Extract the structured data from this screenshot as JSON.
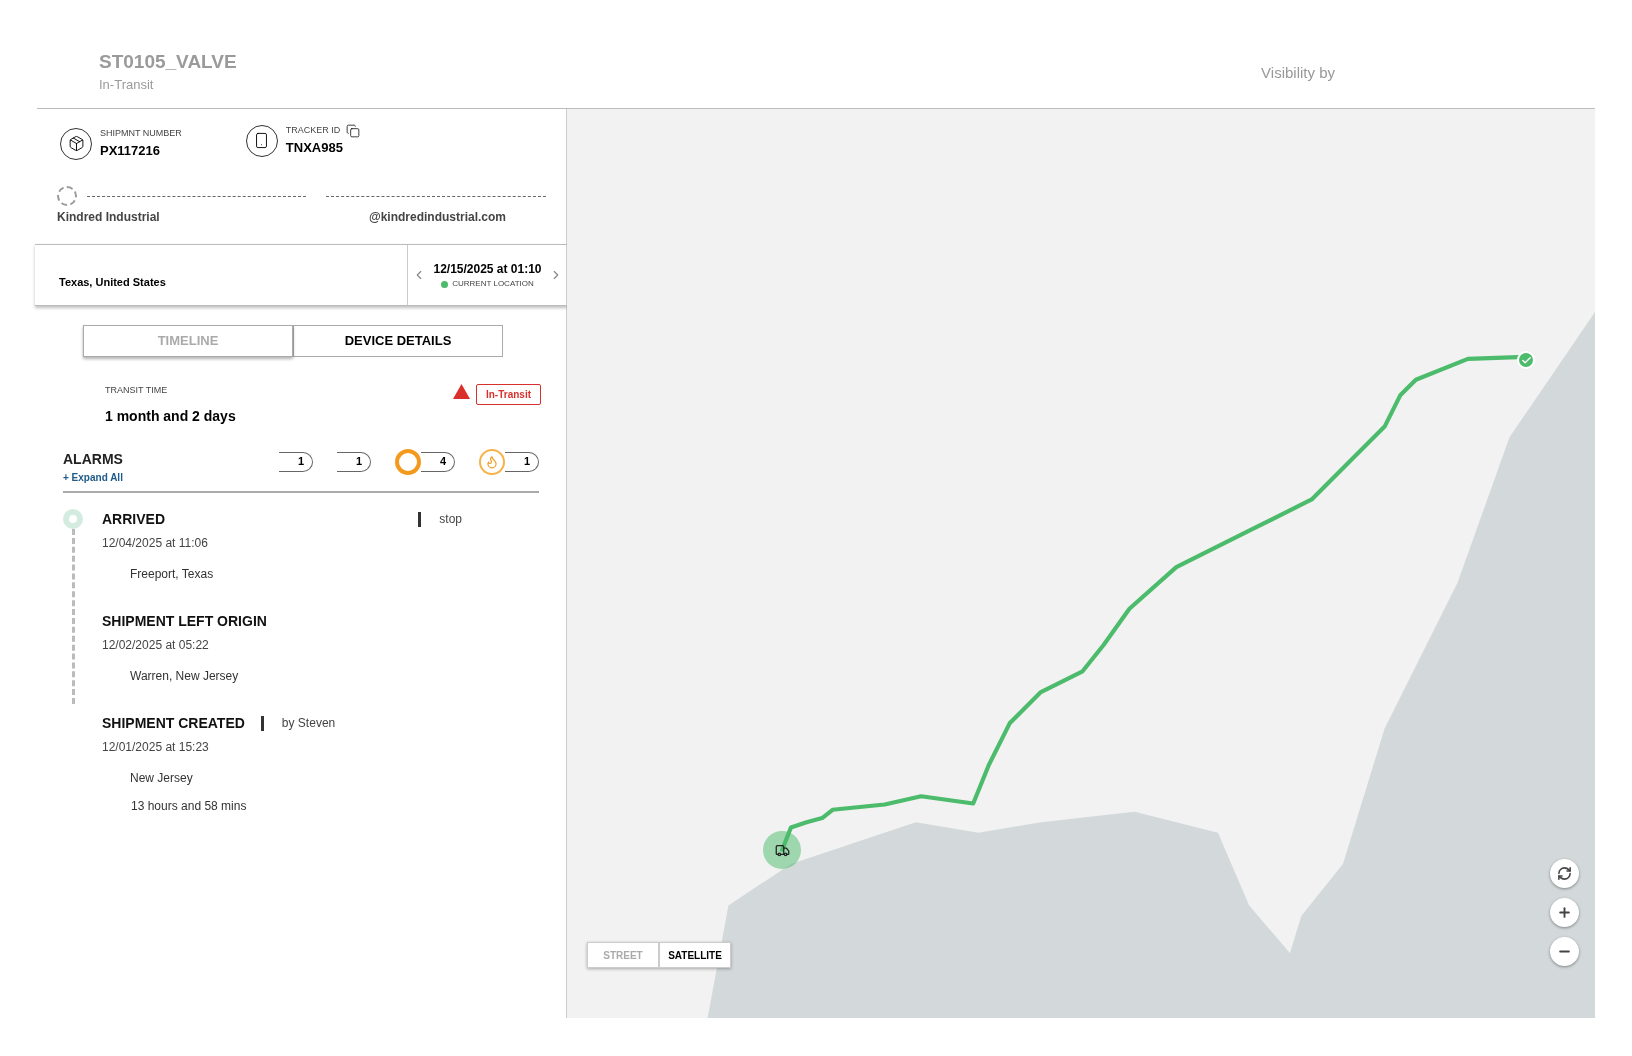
{
  "header": {
    "title": "ST0105_VALVE",
    "status": "In-Transit",
    "brand_text": "Visibility by"
  },
  "shipment": {
    "number_label": "SHIPMNT NUMBER",
    "number": "PX117216",
    "tracker_label": "TRACKER ID",
    "tracker": "TNXA985",
    "company": "Kindred Industrial",
    "email": "@kindredindustrial.com"
  },
  "location": {
    "place": "Texas, United States",
    "time": "12/15/2025 at 01:10",
    "caption": "CURRENT LOCATION"
  },
  "tabs": [
    {
      "label": "TIMELINE",
      "selected": true
    },
    {
      "label": "DEVICE DETAILS",
      "selected": false
    }
  ],
  "transit": {
    "label": "TRANSIT TIME",
    "value": "1 month and 2 days",
    "badge": "In-Transit"
  },
  "alarms": {
    "title": "ALARMS",
    "expand": "+ Expand All",
    "badges": [
      {
        "kind": "blank",
        "count": "1"
      },
      {
        "kind": "blank",
        "count": "1"
      },
      {
        "kind": "ring",
        "count": "4"
      },
      {
        "kind": "flame",
        "count": "1"
      }
    ]
  },
  "events": [
    {
      "title": "ARRIVED",
      "note": "stop",
      "date": "12/04/2025 at 11:06",
      "place": "Freeport, Texas"
    },
    {
      "title": "SHIPMENT LEFT ORIGIN",
      "date": "12/02/2025 at 05:22",
      "place": "Warren, New Jersey"
    },
    {
      "title": "SHIPMENT CREATED",
      "note": "by Steven",
      "date": "12/01/2025 at 15:23",
      "place": "New Jersey",
      "duration": "13 hours and 58 mins"
    }
  ],
  "map_layers": [
    {
      "label": "STREET",
      "selected": true
    },
    {
      "label": "SATELLITE",
      "selected": false
    }
  ]
}
